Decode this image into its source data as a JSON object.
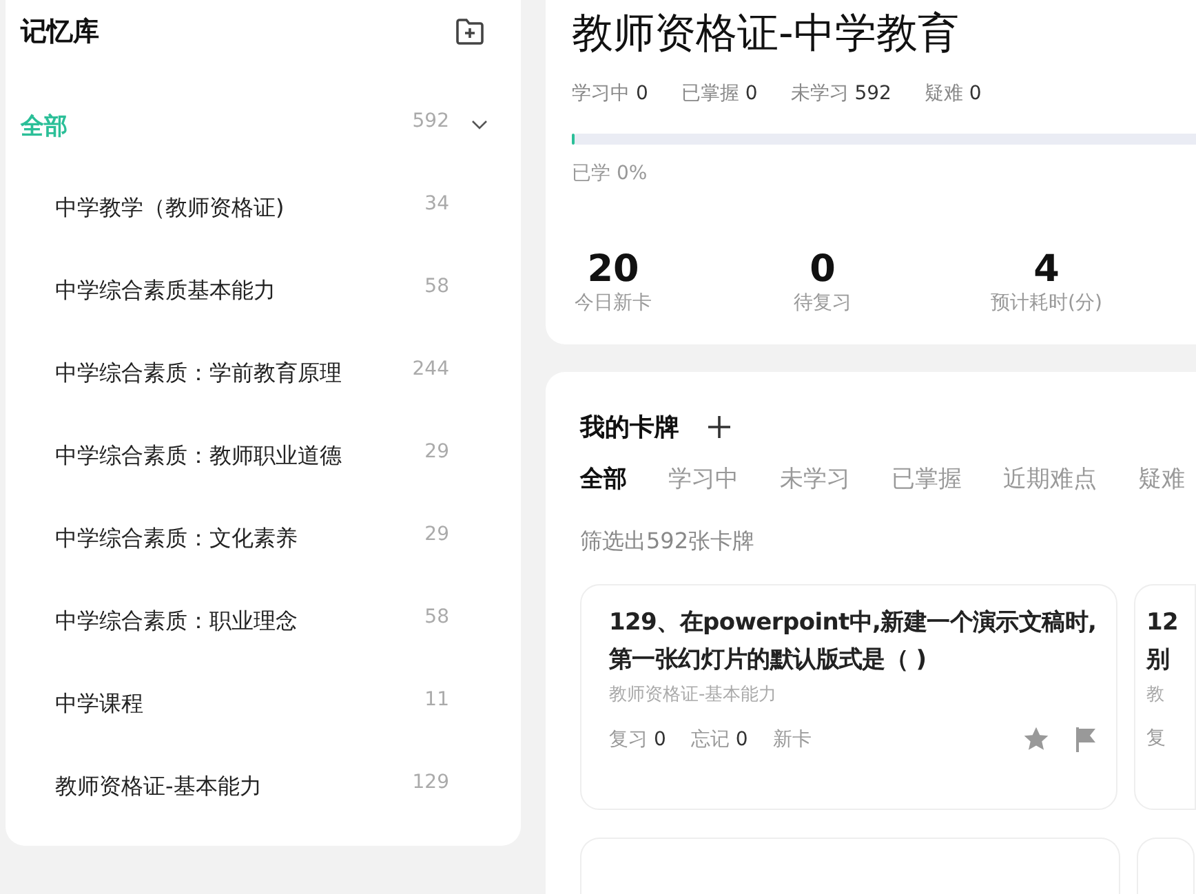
{
  "sidebar": {
    "title": "记忆库",
    "items": [
      {
        "label": "全部",
        "count": "592",
        "selected": true,
        "expanded": true
      },
      {
        "label": "中学教学（教师资格证)",
        "count": "34",
        "selected": false
      },
      {
        "label": "中学综合素质基本能力",
        "count": "58",
        "selected": false
      },
      {
        "label": "中学综合素质：学前教育原理",
        "count": "244",
        "selected": false
      },
      {
        "label": "中学综合素质：教师职业道德",
        "count": "29",
        "selected": false
      },
      {
        "label": "中学综合素质：文化素养",
        "count": "29",
        "selected": false
      },
      {
        "label": "中学综合素质：职业理念",
        "count": "58",
        "selected": false
      },
      {
        "label": "中学课程",
        "count": "11",
        "selected": false
      },
      {
        "label": "教师资格证-基本能力",
        "count": "129",
        "selected": false
      }
    ]
  },
  "deck": {
    "title": "教师资格证-中学教育",
    "counts": [
      {
        "label": "学习中",
        "value": "0"
      },
      {
        "label": "已掌握",
        "value": "0"
      },
      {
        "label": "未学习",
        "value": "592"
      },
      {
        "label": "疑难",
        "value": "0"
      }
    ],
    "progress": {
      "level": 0,
      "label": "已学 0%"
    },
    "stats": [
      {
        "value": "20",
        "label": "今日新卡"
      },
      {
        "value": "0",
        "label": "待复习"
      },
      {
        "value": "4",
        "label": "预计耗时(分)"
      }
    ]
  },
  "cards_section": {
    "title": "我的卡牌",
    "tabs": [
      {
        "label": "全部",
        "selected": true
      },
      {
        "label": "学习中",
        "selected": false
      },
      {
        "label": "未学习",
        "selected": false
      },
      {
        "label": "已掌握",
        "selected": false
      },
      {
        "label": "近期难点",
        "selected": false
      },
      {
        "label": "疑难",
        "selected": false
      }
    ],
    "filter_text": "筛选出592张卡牌",
    "cards": [
      {
        "kind": "full",
        "title": "129、在powerpoint中,新建一个演示文稿时,第一张幻灯片的默认版式是（ )",
        "deck": "教师资格证-基本能力",
        "review": "复习",
        "review_count": "0",
        "forget": "忘记",
        "forget_count": "0",
        "status": "新卡",
        "starred": false,
        "flagged": false
      },
      {
        "kind": "partial",
        "title_lines": [
          "12",
          "别"
        ],
        "deck": "教",
        "footer": "复"
      }
    ]
  }
}
